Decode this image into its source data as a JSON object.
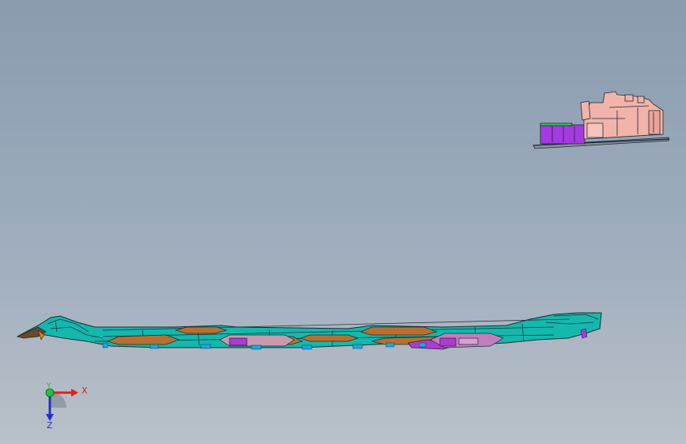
{
  "viewport": {
    "background_top": "#8a9bb0",
    "background_bottom": "#b9c1c9"
  },
  "colors": {
    "teal_shell": "#14b8ad",
    "brown_panel": "#b8702f",
    "magenta_part": "#b03ad0",
    "cyan_clip": "#19a9e0",
    "pink_part": "#f1b3aa",
    "purple_part": "#a43ae2",
    "green_edge": "#2bd14a",
    "edge_dark": "#1c2a30"
  },
  "parts": {
    "rail": {
      "icon": "long-rail-model"
    },
    "bracket": {
      "icon": "bracket-assembly-model"
    }
  },
  "triad": {
    "x_label": "X",
    "y_label": "Y",
    "z_label": "Z",
    "x_color": "#e02020",
    "y_color": "#22c040",
    "z_color": "#2030d0"
  }
}
